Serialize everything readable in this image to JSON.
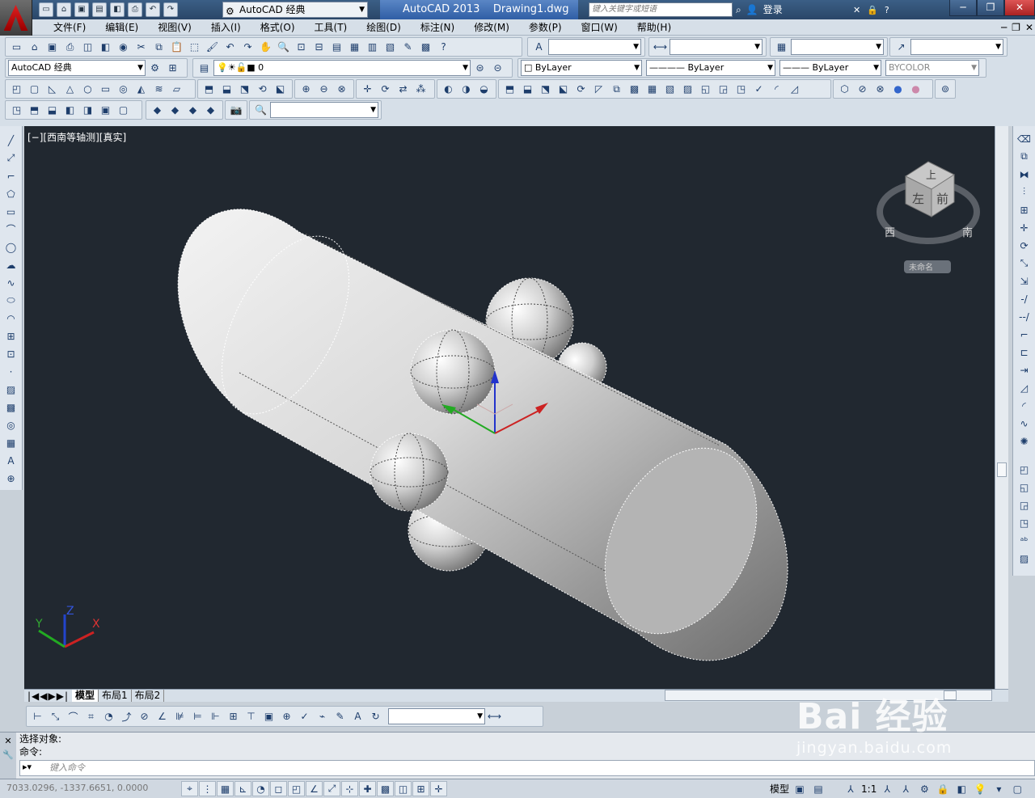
{
  "titlebar": {
    "app_title": "AutoCAD 2013",
    "doc_title": "Drawing1.dwg",
    "workspace": "AutoCAD 经典",
    "search_placeholder": "键入关键字或短语",
    "login_label": "登录"
  },
  "menu": [
    "文件(F)",
    "编辑(E)",
    "视图(V)",
    "插入(I)",
    "格式(O)",
    "工具(T)",
    "绘图(D)",
    "标注(N)",
    "修改(M)",
    "参数(P)",
    "窗口(W)",
    "帮助(H)"
  ],
  "toolbar": {
    "workspace_combo": "AutoCAD 经典",
    "layer_combo": "0",
    "color_combo": "ByLayer",
    "linetype_combo": "ByLayer",
    "lineweight_combo": "ByLayer",
    "plotstyle_combo": "BYCOLOR"
  },
  "viewport": {
    "label": "[−][西南等轴测][真实]",
    "viewcube": {
      "top": "上",
      "left": "左",
      "front": "前",
      "west": "西",
      "south": "南",
      "wcs": "未命名"
    }
  },
  "ucs": {
    "x": "X",
    "y": "Y",
    "z": "Z"
  },
  "tabs": [
    "模型",
    "布局1",
    "布局2"
  ],
  "command": {
    "line1": "选择对象:",
    "line2": "命令:",
    "input_placeholder": "键入命令"
  },
  "status": {
    "coords": "7033.0296, -1337.6651, 0.0000",
    "model_label": "模型",
    "scale_label": "1:1"
  },
  "watermark": {
    "big": "Bai 经验",
    "small": "jingyan.baidu.com"
  }
}
